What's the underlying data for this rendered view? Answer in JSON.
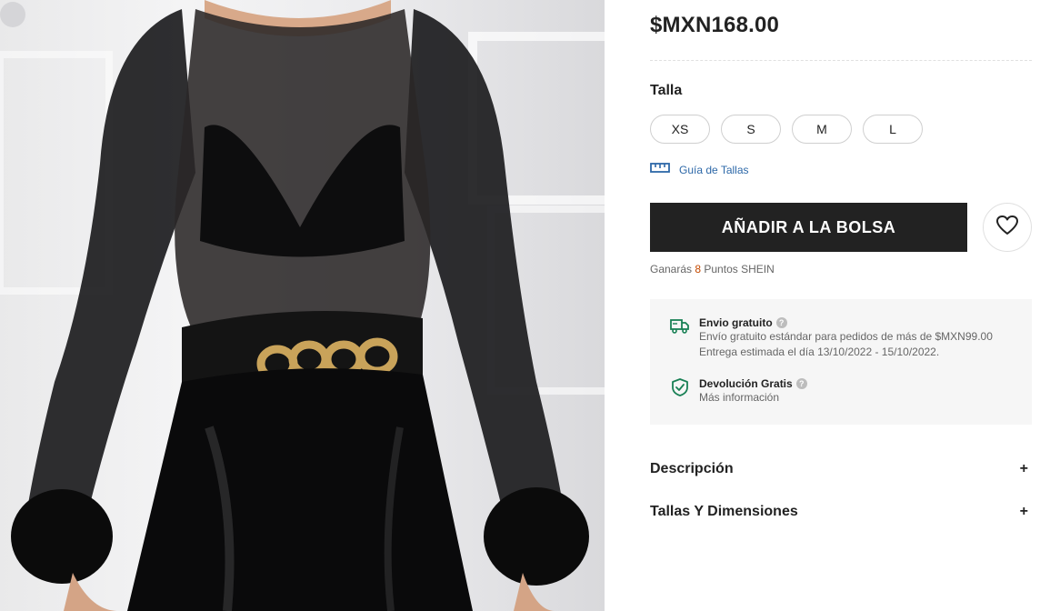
{
  "product": {
    "price": "$MXN168.00",
    "image_alt": "product-photo-black-mesh-bodysuit"
  },
  "size": {
    "title": "Talla",
    "options": [
      "XS",
      "S",
      "M",
      "L"
    ],
    "guide_label": "Guía de Tallas"
  },
  "actions": {
    "add_to_bag": "AÑADIR A LA BOLSA",
    "wishlist_icon": "heart-icon"
  },
  "points": {
    "prefix": "Ganarás ",
    "value": "8",
    "suffix": " Puntos SHEIN"
  },
  "shipping": {
    "free_title": "Envio gratuito",
    "free_line1": "Envío gratuito estándar para pedidos de más de $MXN99.00",
    "free_line2": "Entrega estimada el día 13/10/2022 - 15/10/2022.",
    "return_title": "Devolución Gratis",
    "return_line": "Más información",
    "help_symbol": "?",
    "icons": [
      "truck-icon",
      "shield-check-icon"
    ],
    "accent_color": "#198055"
  },
  "accordion": [
    {
      "label": "Descripción",
      "symbol": "+"
    },
    {
      "label": "Tallas Y Dimensiones",
      "symbol": "+"
    }
  ],
  "colors": {
    "primary_button": "#222222",
    "link": "#2d68a8",
    "points": "#c44a01",
    "panel_bg": "#f6f6f6"
  }
}
